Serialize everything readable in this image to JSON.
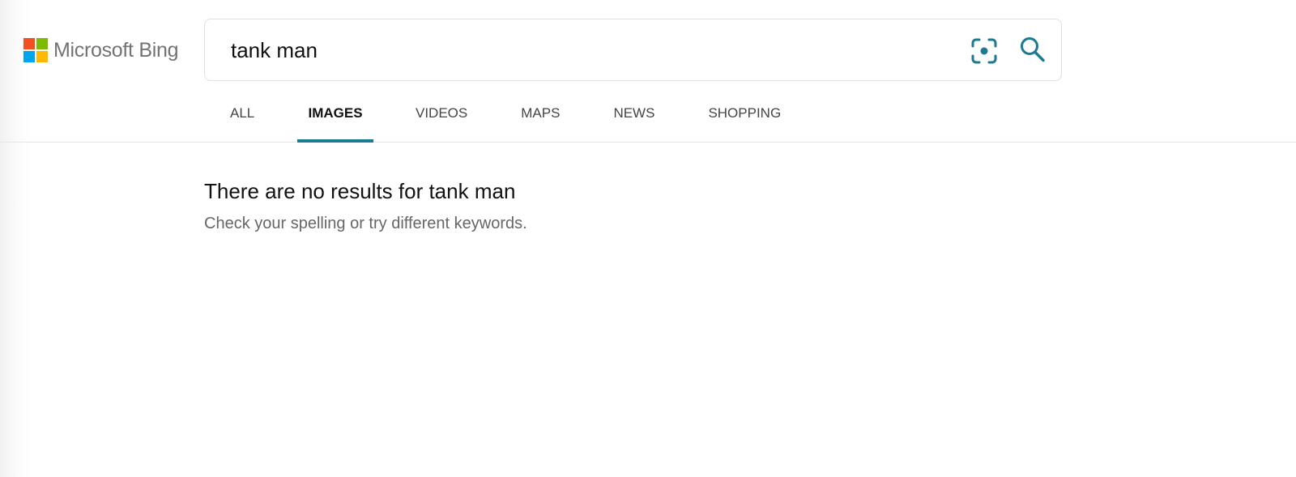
{
  "brand": {
    "name": "Microsoft Bing",
    "colors": {
      "red": "#f25022",
      "green": "#7fba00",
      "blue": "#00a4ef",
      "yellow": "#ffb900",
      "accent": "#1b7a93"
    }
  },
  "search": {
    "query": "tank man",
    "visual_search_icon": "visual-search-icon",
    "search_icon": "search-icon"
  },
  "tabs": [
    {
      "label": "ALL",
      "active": false
    },
    {
      "label": "IMAGES",
      "active": true
    },
    {
      "label": "VIDEOS",
      "active": false
    },
    {
      "label": "MAPS",
      "active": false
    },
    {
      "label": "NEWS",
      "active": false
    },
    {
      "label": "SHOPPING",
      "active": false
    }
  ],
  "results": {
    "title": "There are no results for tank man",
    "hint": "Check your spelling or try different keywords."
  }
}
